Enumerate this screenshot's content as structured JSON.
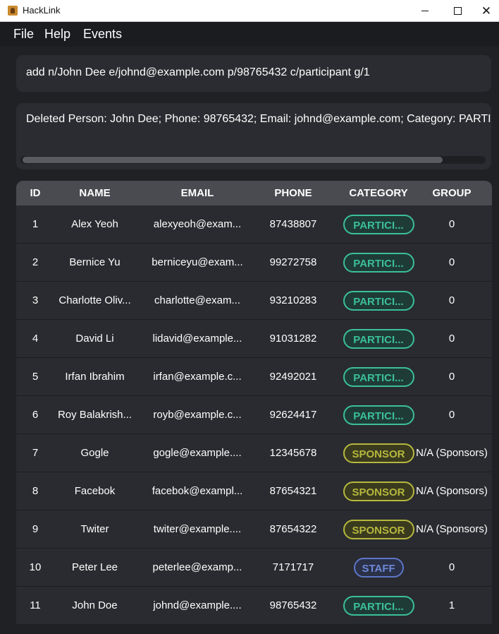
{
  "window": {
    "title": "HackLink"
  },
  "menu": [
    "File",
    "Help",
    "Events"
  ],
  "command": {
    "value": "add n/John Dee e/johnd@example.com p/98765432 c/participant g/1"
  },
  "result": {
    "text": "Deleted Person: John Dee; Phone: 98765432; Email: johnd@example.com; Category: PARTI"
  },
  "colors": {
    "participant": "#3bbf9a",
    "sponsor": "#b5b83e",
    "staff": "#5d76c8",
    "background": "#202124",
    "header": "#4a4b51"
  },
  "table": {
    "columns": [
      "ID",
      "NAME",
      "EMAIL",
      "PHONE",
      "CATEGORY",
      "GROUP"
    ],
    "rows": [
      {
        "id": "1",
        "name": "Alex Yeoh",
        "email": "alexyeoh@exam...",
        "phone": "87438807",
        "category": "PARTICI...",
        "type": "participant",
        "group": "0"
      },
      {
        "id": "2",
        "name": "Bernice Yu",
        "email": "berniceyu@exam...",
        "phone": "99272758",
        "category": "PARTICI...",
        "type": "participant",
        "group": "0"
      },
      {
        "id": "3",
        "name": "Charlotte Oliv...",
        "email": "charlotte@exam...",
        "phone": "93210283",
        "category": "PARTICI...",
        "type": "participant",
        "group": "0"
      },
      {
        "id": "4",
        "name": "David Li",
        "email": "lidavid@example...",
        "phone": "91031282",
        "category": "PARTICI...",
        "type": "participant",
        "group": "0"
      },
      {
        "id": "5",
        "name": "Irfan Ibrahim",
        "email": "irfan@example.c...",
        "phone": "92492021",
        "category": "PARTICI...",
        "type": "participant",
        "group": "0"
      },
      {
        "id": "6",
        "name": "Roy Balakrish...",
        "email": "royb@example.c...",
        "phone": "92624417",
        "category": "PARTICI...",
        "type": "participant",
        "group": "0"
      },
      {
        "id": "7",
        "name": "Gogle",
        "email": "gogle@example....",
        "phone": "12345678",
        "category": "SPONSOR",
        "type": "sponsor",
        "group": "N/A (Sponsors)"
      },
      {
        "id": "8",
        "name": "Facebok",
        "email": "facebok@exampl...",
        "phone": "87654321",
        "category": "SPONSOR",
        "type": "sponsor",
        "group": "N/A (Sponsors)"
      },
      {
        "id": "9",
        "name": "Twiter",
        "email": "twiter@example....",
        "phone": "87654322",
        "category": "SPONSOR",
        "type": "sponsor",
        "group": "N/A (Sponsors)"
      },
      {
        "id": "10",
        "name": "Peter Lee",
        "email": "peterlee@examp...",
        "phone": "7171717",
        "category": "STAFF",
        "type": "staff",
        "group": "0"
      },
      {
        "id": "11",
        "name": "John Doe",
        "email": "johnd@example....",
        "phone": "98765432",
        "category": "PARTICI...",
        "type": "participant",
        "group": "1"
      }
    ]
  }
}
